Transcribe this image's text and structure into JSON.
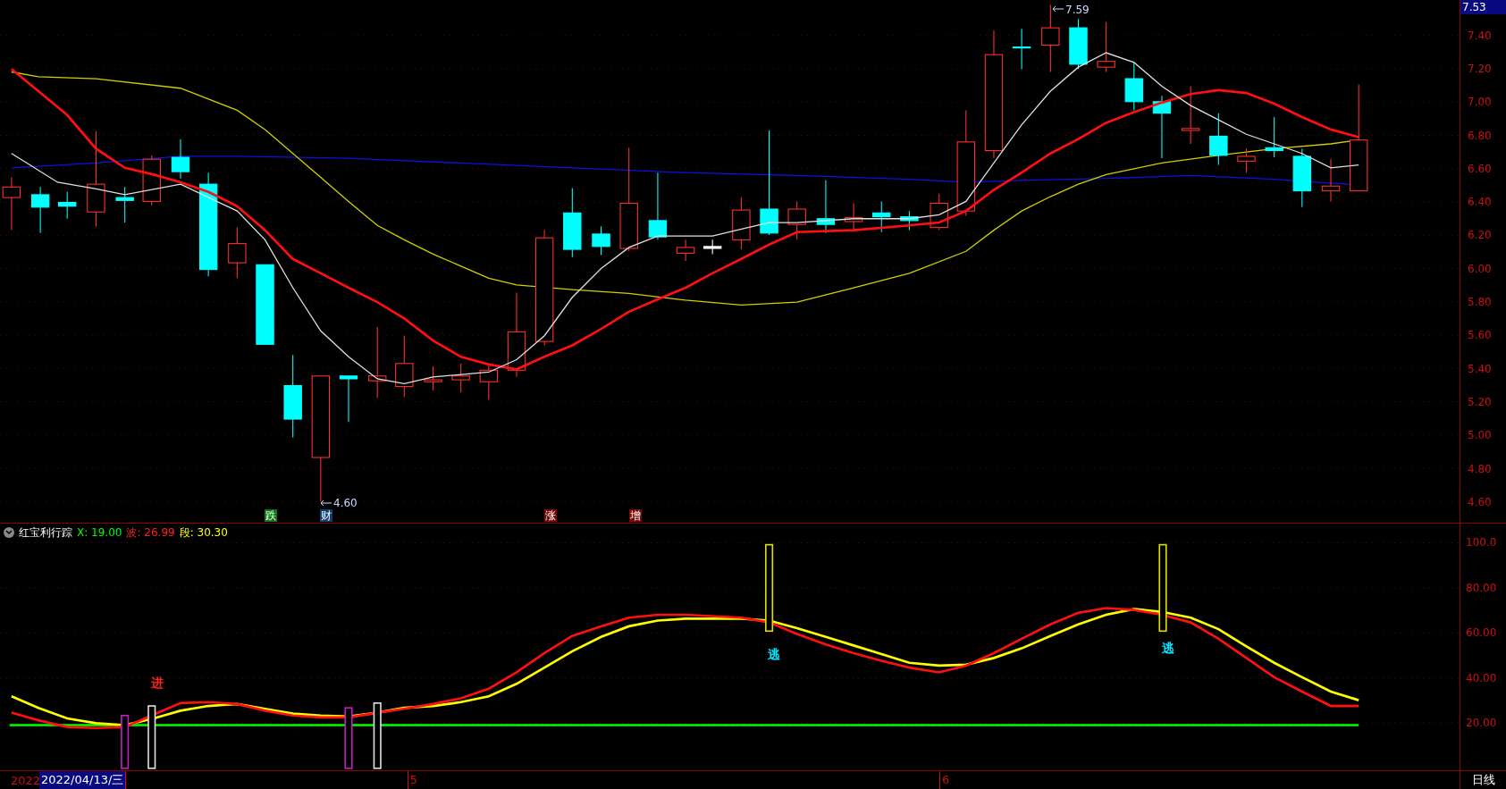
{
  "price_axis": {
    "current": "7.53",
    "ticks": [
      "7.40",
      "7.20",
      "7.00",
      "6.80",
      "6.60",
      "6.40",
      "6.20",
      "6.00",
      "5.80",
      "5.60",
      "5.40",
      "5.20",
      "5.00",
      "4.80",
      "4.60"
    ]
  },
  "main_chart": {
    "high_label": "7.59",
    "low_label": "4.60",
    "tags": [
      {
        "text": "跌",
        "color": "#0b7a12"
      },
      {
        "text": "财",
        "color": "#0d3f73"
      },
      {
        "text": "涨",
        "color": "#7a0a0a"
      },
      {
        "text": "增",
        "color": "#7a0a0a"
      }
    ]
  },
  "indicator": {
    "name": "红宝利行踪",
    "values": [
      {
        "label": "X: 19.00",
        "color": "#00ff00"
      },
      {
        "label": "波: 26.99",
        "color": "#ff2020"
      },
      {
        "label": "段: 30.30",
        "color": "#ffff00"
      }
    ],
    "signals": [
      {
        "text": "进",
        "color": "#ff2020"
      },
      {
        "text": "逃",
        "color": "#00e5ff"
      },
      {
        "text": "逃",
        "color": "#00e5ff"
      }
    ],
    "ticks": [
      "100.0",
      "80.00",
      "60.00",
      "40.00",
      "20.00"
    ]
  },
  "bottom_bar": {
    "start_label": "2022",
    "cursor_date": "2022/04/13/三",
    "months": [
      "5",
      "6"
    ],
    "period": "日线"
  }
}
